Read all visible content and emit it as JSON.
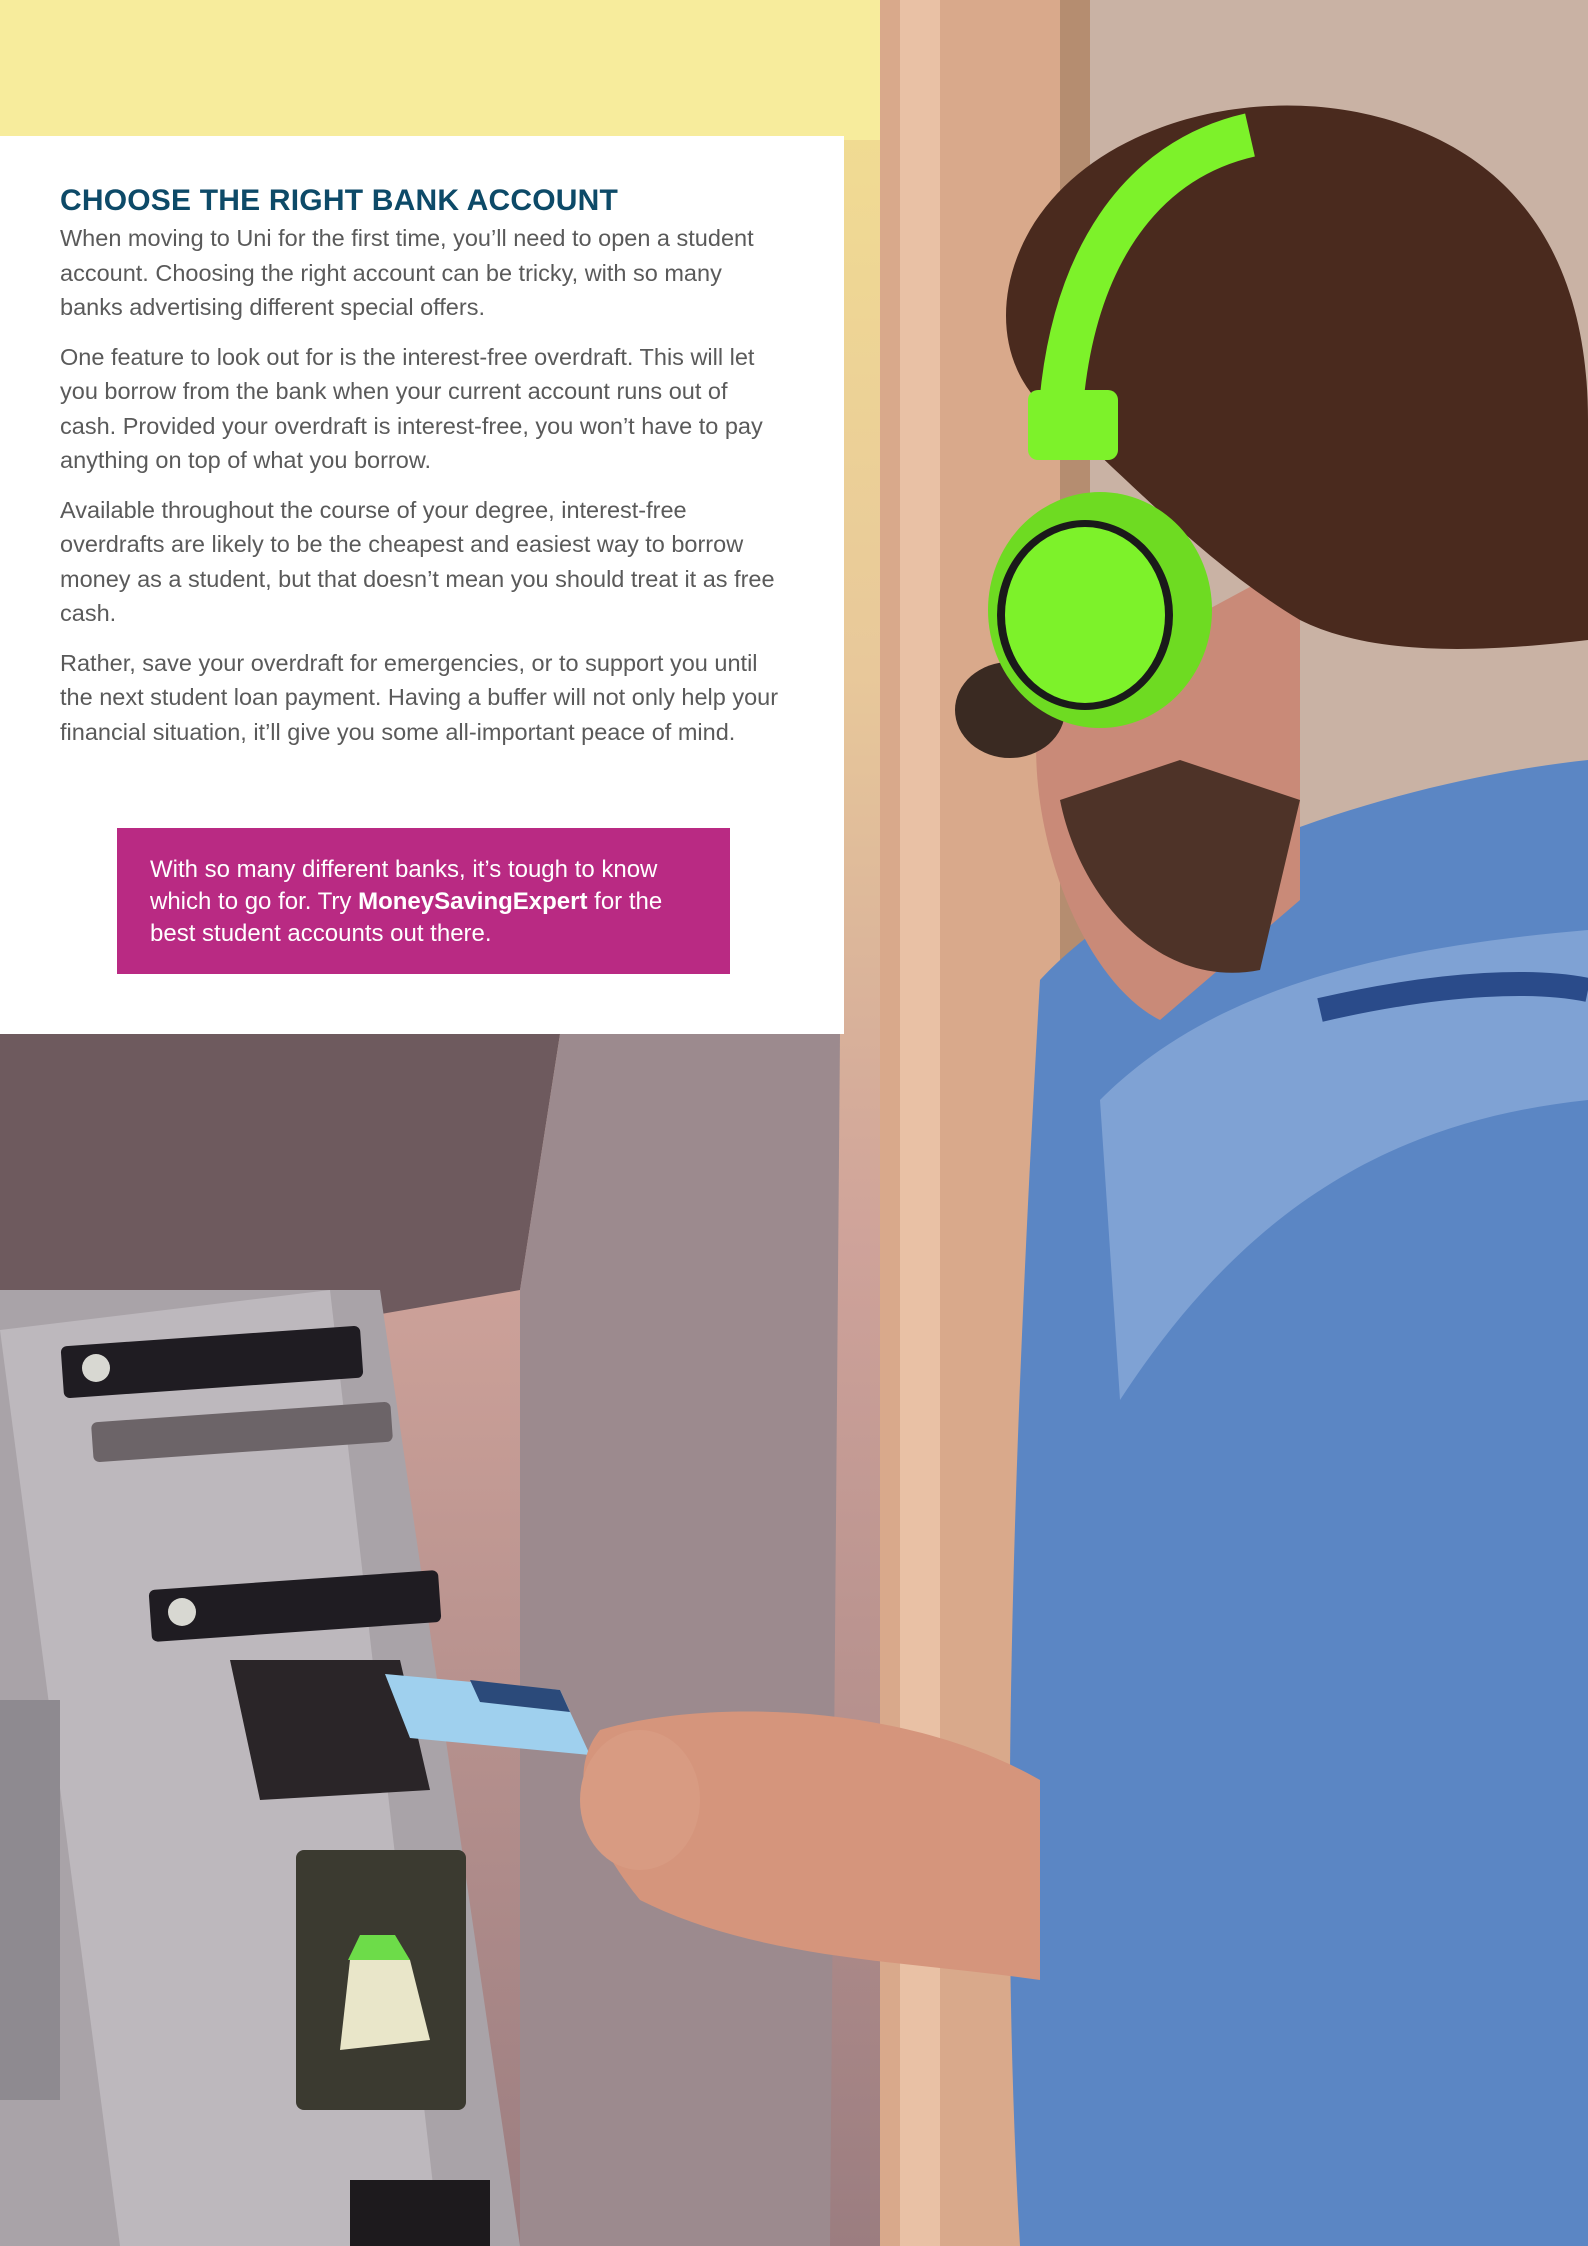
{
  "article": {
    "heading": "CHOOSE THE RIGHT BANK ACCOUNT",
    "paragraphs": [
      "When moving to Uni for the first time, you’ll need to open a student account. Choosing the right account can be tricky, with so many banks advertising different special offers.",
      "One feature to look out for is the interest-free overdraft. This will let you borrow from the bank when your current account runs out of cash. Provided your overdraft is interest-free, you won’t have to pay anything on top of what you borrow.",
      "Available throughout the course of your degree, interest-free overdrafts are likely to be the cheapest and easiest way to borrow money as a student, but that doesn’t mean you should treat it as free cash.",
      "Rather, save your overdraft for emergencies, or to support you until the next student loan payment. Having a buffer will not only help your financial situation, it’ll give you some all-important peace of mind."
    ]
  },
  "callout": {
    "text_before": "With so many different banks, it’s tough to know which to go for. Try ",
    "link_text": "MoneySavingExpert",
    "text_after": " for the best student accounts out there."
  },
  "colors": {
    "heading": "#0d4a68",
    "body_text": "#5a5a5a",
    "callout_bg": "#b92a83",
    "headphones": "#7df22a",
    "shirt": "#5b86c4"
  },
  "photo": {
    "description_icon": "atm-photo"
  }
}
